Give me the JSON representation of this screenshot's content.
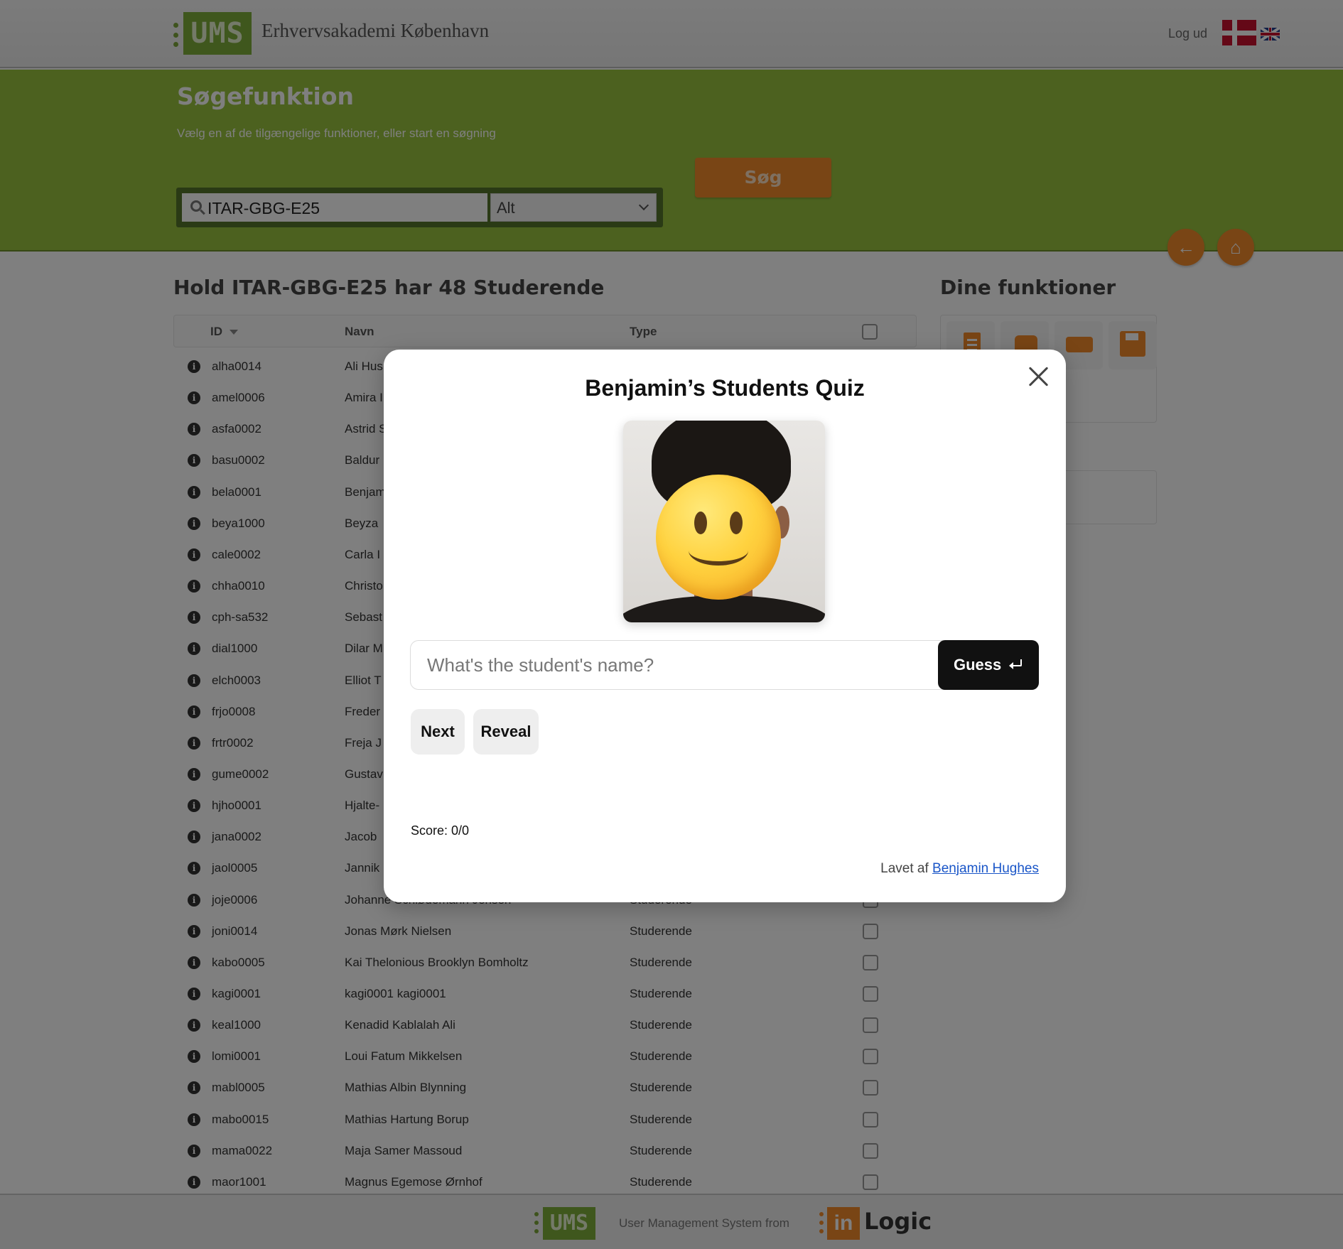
{
  "header": {
    "logo_text": "UMS",
    "org_name": "Erhvervsakademi København",
    "logout_label": "Log ud"
  },
  "search": {
    "title": "Søgefunktion",
    "subtitle": "Vælg en af de tilgængelige funktioner, eller start en søgning",
    "query": "ITAR-GBG-E25",
    "filter_value": "Alt",
    "button_label": "Søg"
  },
  "list": {
    "title": "Hold ITAR-GBG-E25 har 48 Studerende",
    "columns": {
      "id": "ID",
      "name": "Navn",
      "type": "Type"
    },
    "rows": [
      {
        "id": "alha0014",
        "name": "Ali Hus",
        "type": ""
      },
      {
        "id": "amel0006",
        "name": "Amira I",
        "type": ""
      },
      {
        "id": "asfa0002",
        "name": "Astrid S",
        "type": ""
      },
      {
        "id": "basu0002",
        "name": "Baldur",
        "type": ""
      },
      {
        "id": "bela0001",
        "name": "Benjam",
        "type": ""
      },
      {
        "id": "beya1000",
        "name": "Beyza",
        "type": ""
      },
      {
        "id": "cale0002",
        "name": "Carla I",
        "type": ""
      },
      {
        "id": "chha0010",
        "name": "Christo",
        "type": ""
      },
      {
        "id": "cph-sa532",
        "name": "Sebast",
        "type": ""
      },
      {
        "id": "dial1000",
        "name": "Dilar M",
        "type": ""
      },
      {
        "id": "elch0003",
        "name": "Elliot T",
        "type": ""
      },
      {
        "id": "frjo0008",
        "name": "Freder",
        "type": ""
      },
      {
        "id": "frtr0002",
        "name": "Freja J",
        "type": ""
      },
      {
        "id": "gume0002",
        "name": "Gustav",
        "type": ""
      },
      {
        "id": "hjho0001",
        "name": "Hjalte-",
        "type": ""
      },
      {
        "id": "jana0002",
        "name": "Jacob",
        "type": ""
      },
      {
        "id": "jaol0005",
        "name": "Jannik",
        "type": ""
      },
      {
        "id": "joje0006",
        "name": "Johanne Schiødemann Jensen",
        "type": "Studerende"
      },
      {
        "id": "joni0014",
        "name": "Jonas Mørk Nielsen",
        "type": "Studerende"
      },
      {
        "id": "kabo0005",
        "name": "Kai Thelonious Brooklyn Bomholtz",
        "type": "Studerende"
      },
      {
        "id": "kagi0001",
        "name": "kagi0001 kagi0001",
        "type": "Studerende"
      },
      {
        "id": "keal1000",
        "name": "Kenadid Kablalah Ali",
        "type": "Studerende"
      },
      {
        "id": "lomi0001",
        "name": "Loui Fatum Mikkelsen",
        "type": "Studerende"
      },
      {
        "id": "mabl0005",
        "name": "Mathias Albin Blynning",
        "type": "Studerende"
      },
      {
        "id": "mabo0015",
        "name": "Mathias Hartung Borup",
        "type": "Studerende"
      },
      {
        "id": "mama0022",
        "name": "Maja Samer Massoud",
        "type": "Studerende"
      },
      {
        "id": "maor1001",
        "name": "Magnus Egemose Ørnhof",
        "type": "Studerende"
      }
    ]
  },
  "functions": {
    "title": "Dine funktioner",
    "icons": [
      "document-icon",
      "bin-icon",
      "printer-icon",
      "save-icon"
    ]
  },
  "footer": {
    "ums_text": "UMS",
    "text": "User Management System from",
    "in_text": "in",
    "logic_text": "Logic"
  },
  "modal": {
    "title": "Benjamin’s Students Quiz",
    "input_placeholder": "What's the student's name?",
    "guess_label": "Guess",
    "next_label": "Next",
    "reveal_label": "Reveal",
    "score": "Score: 0/0",
    "credit_prefix": "Lavet af",
    "credit_name": "Benjamin Hughes"
  },
  "colors": {
    "brand_green": "#98c23f",
    "brand_orange": "#f38a2a",
    "overlay": "rgba(0,0,0,0.5)"
  }
}
